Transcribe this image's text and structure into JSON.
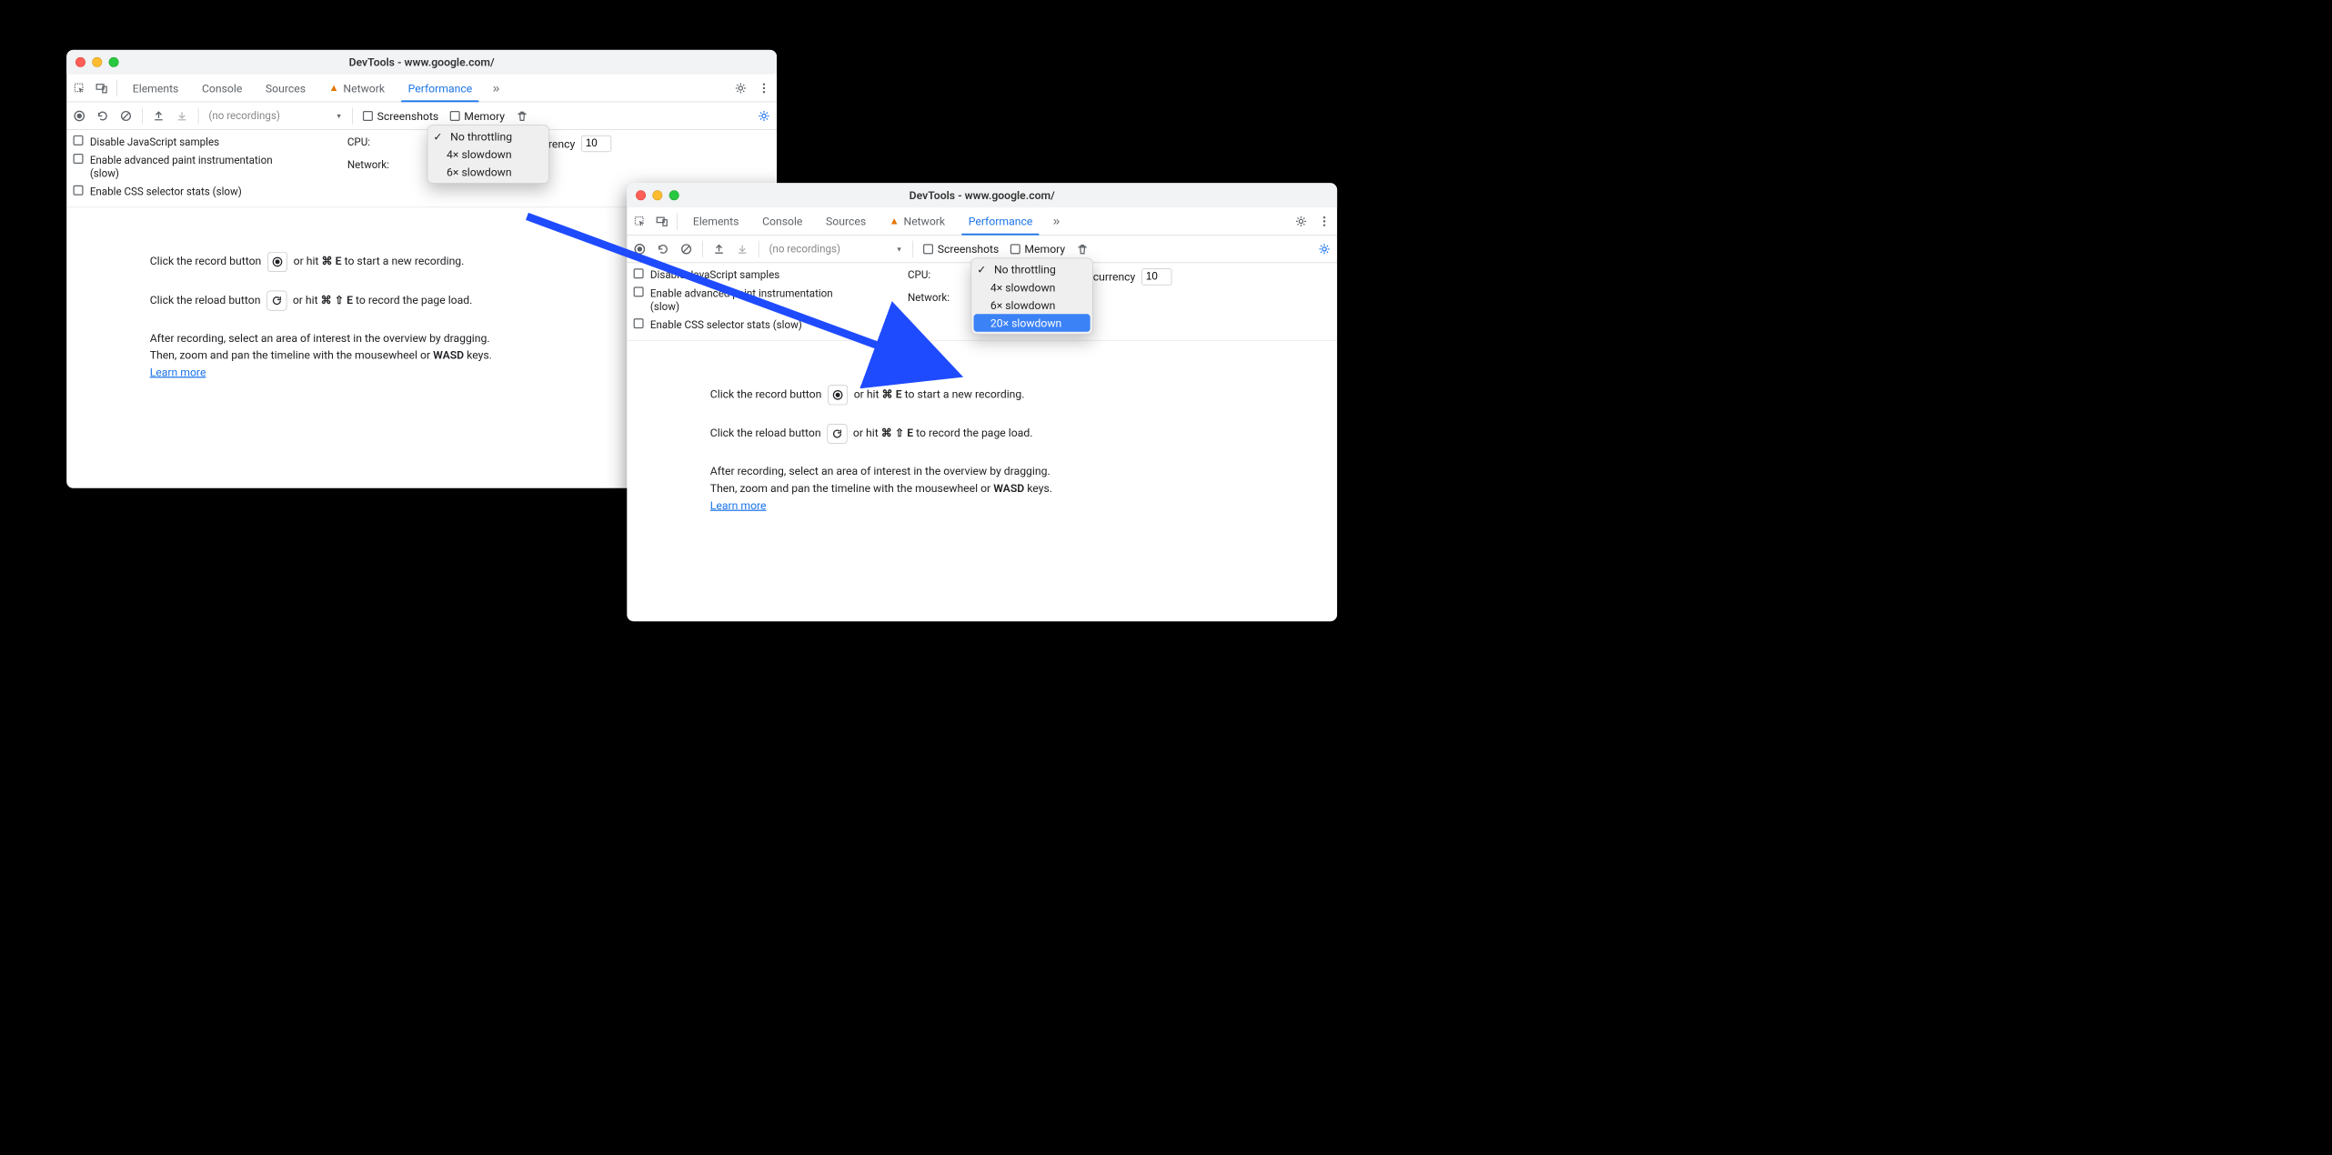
{
  "window_title": "DevTools - www.google.com/",
  "tabs": {
    "elements": "Elements",
    "console": "Console",
    "sources": "Sources",
    "network": "Network",
    "performance": "Performance"
  },
  "toolbar": {
    "no_recordings": "(no recordings)",
    "screenshots_label": "Screenshots",
    "memory_label": "Memory"
  },
  "settings": {
    "disable_js": "Disable JavaScript samples",
    "enable_paint": "Enable advanced paint instrumentation (slow)",
    "enable_css": "Enable CSS selector stats (slow)",
    "cpu_label": "CPU:",
    "network_label": "Network:",
    "hw_concurrency_label": "Hardware concurrency",
    "hw_concurrency_value": "10"
  },
  "cpu_dropdown": {
    "no_throttling": "No throttling",
    "x4": "4× slowdown",
    "x6": "6× slowdown",
    "x20": "20× slowdown"
  },
  "help": {
    "line1_a": "Click the record button ",
    "line1_b": " or hit ",
    "line1_cmd": "⌘ E",
    "line1_c": " to start a new recording.",
    "line2_a": "Click the reload button ",
    "line2_b": " or hit ",
    "line2_cmd": "⌘ ⇧ E",
    "line2_c": " to record the page load.",
    "after1": "After recording, select an area of interest in the overview by dragging.",
    "after2_a": "Then, zoom and pan the timeline with the mousewheel or ",
    "after2_b": "WASD",
    "after2_c": " keys.",
    "learn_more": "Learn more"
  }
}
